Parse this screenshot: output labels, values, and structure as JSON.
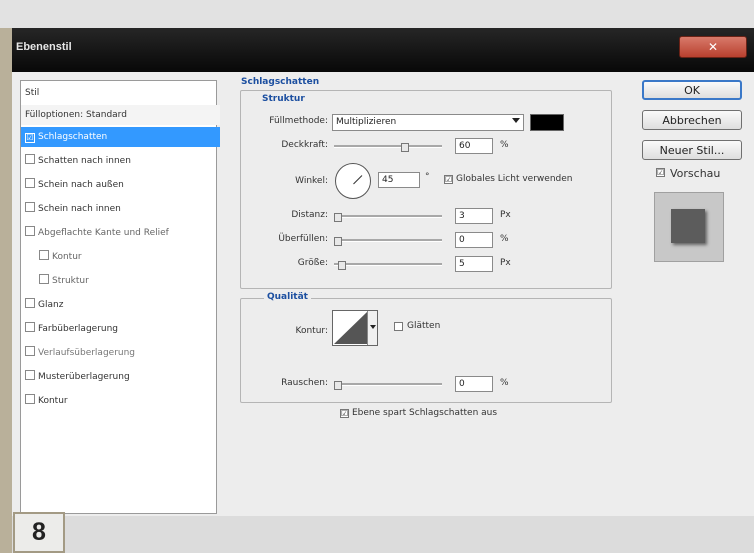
{
  "window": {
    "title": "Ebenenstil",
    "close_glyph": "✕"
  },
  "sidebar": {
    "search_value": "Stil",
    "header": "Fülloptionen: Standard",
    "items": [
      {
        "label": "Schlagschatten",
        "checked": true
      },
      {
        "label": "Schatten nach innen",
        "checked": false
      },
      {
        "label": "Schein nach außen",
        "checked": false
      },
      {
        "label": "Schein nach innen",
        "checked": false
      },
      {
        "label": "Abgeflachte Kante und Relief",
        "checked": false
      },
      {
        "label": "Kontur",
        "checked": false
      },
      {
        "label": "Struktur",
        "checked": false
      },
      {
        "label": "Glanz",
        "checked": false
      },
      {
        "label": "Farbüberlagerung",
        "checked": false
      },
      {
        "label": "Verlaufsüberlagerung",
        "checked": false
      },
      {
        "label": "Musterüberlagerung",
        "checked": false
      },
      {
        "label": "Kontur",
        "checked": false
      }
    ],
    "check_mark": "☑"
  },
  "panel": {
    "title": "Schlagschatten",
    "structure": {
      "title": "Struktur",
      "blend_mode_label": "Füllmethode:",
      "blend_mode_value": "Multiplizieren",
      "shadow_color": "#000000",
      "opacity_label": "Deckkraft:",
      "opacity_value": "60",
      "opacity_unit": "%",
      "angle_label": "Winkel:",
      "angle_value": "45",
      "angle_unit": "°",
      "global_light_label": "Globales Licht verwenden",
      "global_light_checked": true,
      "distance_label": "Distanz:",
      "distance_value": "3",
      "distance_unit": "Px",
      "spread_label": "Überfüllen:",
      "spread_value": "0",
      "spread_unit": "%",
      "size_label": "Größe:",
      "size_value": "5",
      "size_unit": "Px"
    },
    "quality": {
      "title": "Qualität",
      "contour_label": "Kontur:",
      "antialias_label": "Glätten",
      "antialias_checked": false,
      "noise_label": "Rauschen:",
      "noise_value": "0",
      "noise_unit": "%"
    },
    "knockout_label": "Ebene spart Schlagschatten aus",
    "knockout_checked": true
  },
  "buttons": {
    "ok": "OK",
    "cancel": "Abbrechen",
    "new_style": "Neuer Stil...",
    "preview_label": "Vorschau",
    "preview_checked": true
  },
  "badge": {
    "number": "8"
  }
}
